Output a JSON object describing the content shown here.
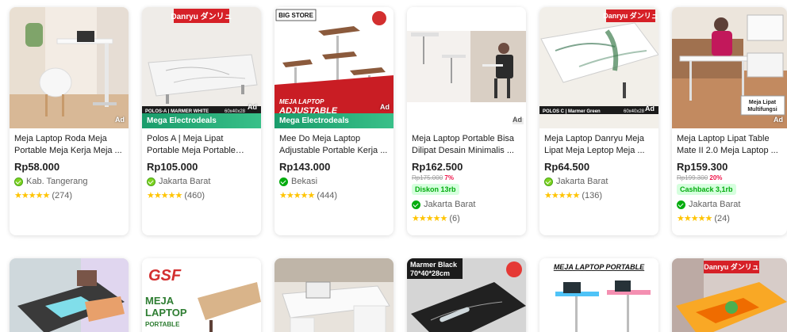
{
  "products": [
    {
      "title": "Meja Laptop Roda Meja Portable Meja Kerja Meja ...",
      "price": "Rp58.000",
      "shop": "Kab. Tangerang",
      "shop_badge": "official-store",
      "stars": "★★★★★",
      "reviews": "(274)",
      "ad": "Ad"
    },
    {
      "title": "Polos A | Meja Lipat Portable Meja Portable Me...",
      "price": "Rp105.000",
      "shop": "Jakarta Barat",
      "shop_badge": "official-store",
      "stars": "★★★★★",
      "reviews": "(460)",
      "ad": "Ad",
      "strip": "Mega Electrodeals",
      "brand": "Danryu ダンリュ",
      "banner": "POLOS-A | MARMER WHITE",
      "size": "60x40x28"
    },
    {
      "title": "Mee Do Meja Laptop Adjustable Portable Kerja ...",
      "price": "Rp143.000",
      "shop": "Bekasi",
      "shop_badge": "power-merchant",
      "stars": "★★★★★",
      "reviews": "(444)",
      "ad": "Ad",
      "strip": "Mega Electrodeals",
      "brand": "BIG STORE",
      "banner_line1": "MEJA LAPTOP",
      "banner_line2": "ADJUSTABLE"
    },
    {
      "title": "Meja Laptop Portable Bisa Dilipat Desain Minimalis ...",
      "price": "Rp162.500",
      "old_price": "Rp175.000",
      "discount": "7%",
      "promo": "Diskon 13rb",
      "shop": "Jakarta Barat",
      "shop_badge": "power-merchant",
      "stars": "★★★★★",
      "reviews": "(6)",
      "ad": "Ad"
    },
    {
      "title": "Meja Laptop Danryu Meja Lipat Meja Leptop Meja ...",
      "price": "Rp64.500",
      "shop": "Jakarta Barat",
      "shop_badge": "official-store",
      "stars": "★★★★★",
      "reviews": "(136)",
      "ad": "Ad",
      "brand": "Danryu ダンリュ",
      "banner": "POLOS C | Marmer Green",
      "size": "60x40x28"
    },
    {
      "title": "Meja Laptop Lipat Table Mate II 2.0 Meja Laptop ...",
      "price": "Rp159.300",
      "old_price": "Rp199.300",
      "discount": "20%",
      "promo": "Cashback 3,1rb",
      "shop": "Jakarta Barat",
      "shop_badge": "power-merchant",
      "stars": "★★★★★",
      "reviews": "(24)",
      "ad": "Ad",
      "overlay": "Meja Lipat Multifungsi"
    }
  ],
  "row2": [
    {
      "label": ""
    },
    {
      "brand": "GSF",
      "line1": "MEJA",
      "line2": "LAPTOP",
      "line3": "PORTABLE"
    },
    {
      "label": ""
    },
    {
      "label": "Marmer Black 70*40*28cm"
    },
    {
      "label": "MEJA LAPTOP PORTABLE"
    },
    {
      "brand": "Danryu ダンリュ"
    }
  ],
  "colors": {
    "star": "#ffc400",
    "price": "#212121",
    "strip": "#1a9c6b",
    "discount": "#ef144a",
    "promo_text": "#03ac0e",
    "promo_bg": "#d6ffde"
  }
}
